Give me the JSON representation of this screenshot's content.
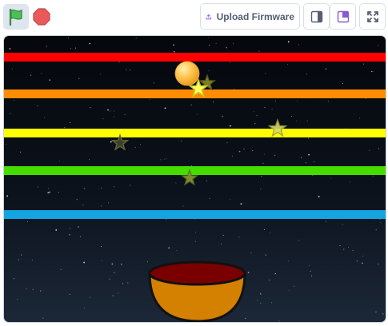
{
  "toolbar": {
    "green_flag": {
      "icon": "green-flag-icon",
      "color": "#4cbf56"
    },
    "stop": {
      "icon": "stop-sign-icon",
      "color": "#ec5959"
    },
    "upload_firmware_label": "Upload Firmware",
    "upload_icon": "upload-icon",
    "small_stage_icon": "small-stage-icon",
    "large_stage_icon": "large-stage-icon",
    "fullscreen_icon": "fullscreen-icon"
  },
  "stage": {
    "background": "starry-night-sky",
    "lanes": [
      {
        "name": "red-lane",
        "color": "#ff0000"
      },
      {
        "name": "orange-lane",
        "color": "#ff8c00"
      },
      {
        "name": "yellow-lane",
        "color": "#ffff00"
      },
      {
        "name": "green-lane",
        "color": "#44dd00"
      },
      {
        "name": "blue-lane",
        "color": "#14a5e0"
      }
    ],
    "sprites": {
      "ball": {
        "color": "#ffc34d"
      },
      "stars": [
        {
          "name": "star-1",
          "state": "bright"
        },
        {
          "name": "star-2",
          "state": "faded"
        },
        {
          "name": "star-3",
          "state": "faded"
        },
        {
          "name": "star-4",
          "state": "faded"
        },
        {
          "name": "star-5",
          "state": "dark"
        }
      ],
      "bowl": {
        "outer_color": "#d48000",
        "inner_color": "#7a0000"
      }
    }
  }
}
